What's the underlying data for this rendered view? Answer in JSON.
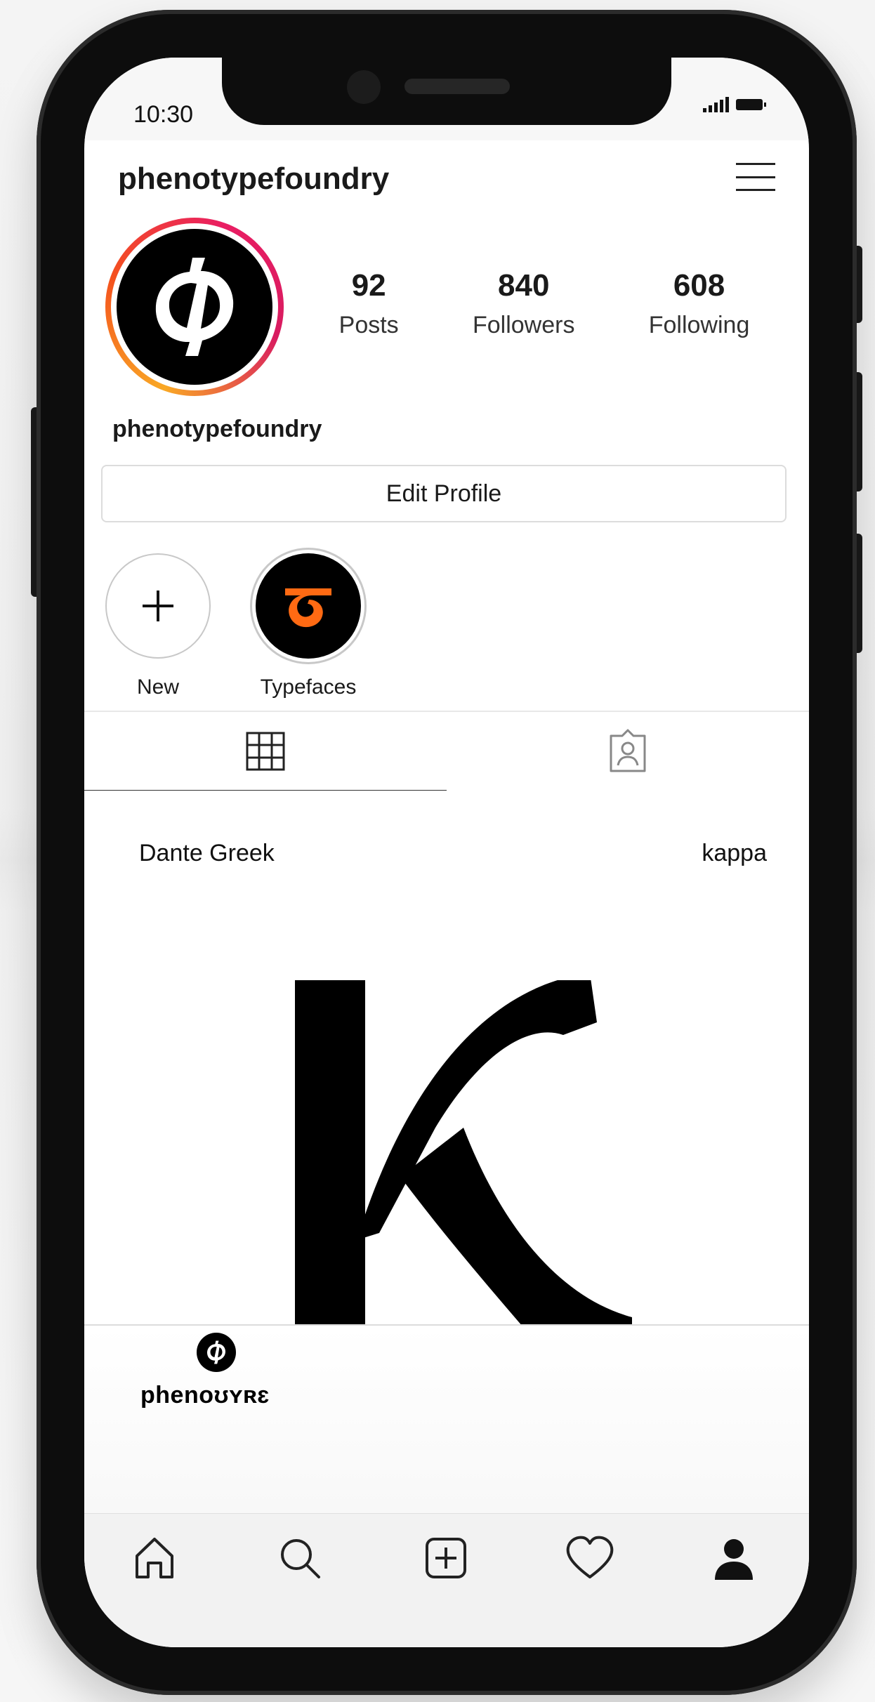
{
  "status_bar": {
    "time": "10:30"
  },
  "header": {
    "username": "phenotypefoundry",
    "menu_icon": "hamburger-menu-icon"
  },
  "profile": {
    "avatar_icon": "phenotype-logo-icon",
    "ring_colors": [
      "#f9a825",
      "#f4511e",
      "#e91e63"
    ],
    "name": "phenotypefoundry",
    "stats": [
      {
        "value": "92",
        "label": "Posts"
      },
      {
        "value": "840",
        "label": "Followers"
      },
      {
        "value": "608",
        "label": "Following"
      }
    ],
    "edit_button_label": "Edit Profile"
  },
  "highlights": [
    {
      "label": "New",
      "icon": "plus-icon"
    },
    {
      "label": "Typefaces",
      "icon": "typefaces-glyph-icon",
      "glyph_color": "#ff6a13"
    }
  ],
  "tabs": [
    {
      "name": "grid",
      "icon": "grid-icon",
      "active": true
    },
    {
      "name": "tagged",
      "icon": "tagged-user-icon",
      "active": false
    }
  ],
  "post": {
    "title_left": "Dante Greek",
    "title_right": "kappa",
    "glyph": "K"
  },
  "brand": {
    "wordmark": "phenoʊʏʀɛ",
    "icon": "phenotype-logo-icon"
  },
  "bottom_nav": [
    {
      "name": "home",
      "icon": "home-icon"
    },
    {
      "name": "search",
      "icon": "search-icon"
    },
    {
      "name": "create",
      "icon": "add-post-icon"
    },
    {
      "name": "activity",
      "icon": "heart-icon"
    },
    {
      "name": "profile",
      "icon": "profile-icon"
    }
  ]
}
